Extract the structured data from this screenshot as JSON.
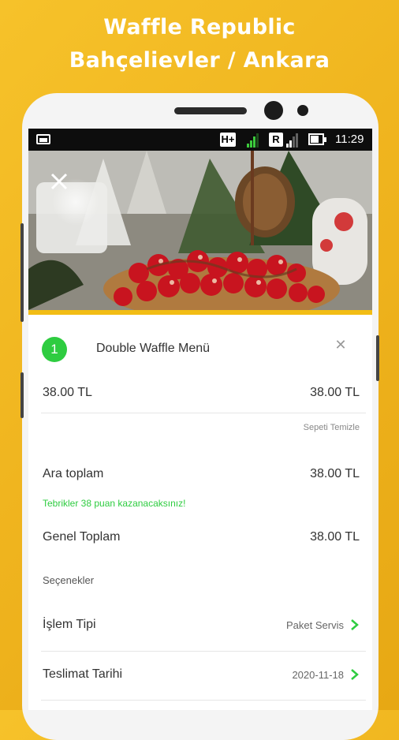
{
  "promo": {
    "line1": "Waffle Republic",
    "line2": "Bahçelievler / Ankara"
  },
  "status_bar": {
    "time": "11:29",
    "network_badge": "H+",
    "roaming_badge": "R",
    "signal_level_1": 0.75,
    "signal_level_2": 0.5,
    "battery_level": 0.8
  },
  "cart": {
    "item": {
      "quantity": "1",
      "name": "Double Waffle Menü",
      "unit_price": "38.00 TL",
      "total_price": "38.00 TL",
      "remove_icon": "close-icon"
    },
    "clear_cart_label": "Sepeti Temizle",
    "subtotal": {
      "label": "Ara toplam",
      "value": "38.00 TL"
    },
    "points_message": "Tebrikler 38 puan kazanacaksınız!",
    "grand_total": {
      "label": "Genel Toplam",
      "value": "38.00 TL"
    }
  },
  "options": {
    "section_label": "Seçenekler",
    "rows": [
      {
        "label": "İşlem Tipi",
        "value": "Paket Servis"
      },
      {
        "label": "Teslimat Tarihi",
        "value": "2020-11-18"
      }
    ]
  },
  "colors": {
    "brand_yellow": "#f2bd15",
    "accent_green": "#2ecc40",
    "text": "#333333"
  }
}
